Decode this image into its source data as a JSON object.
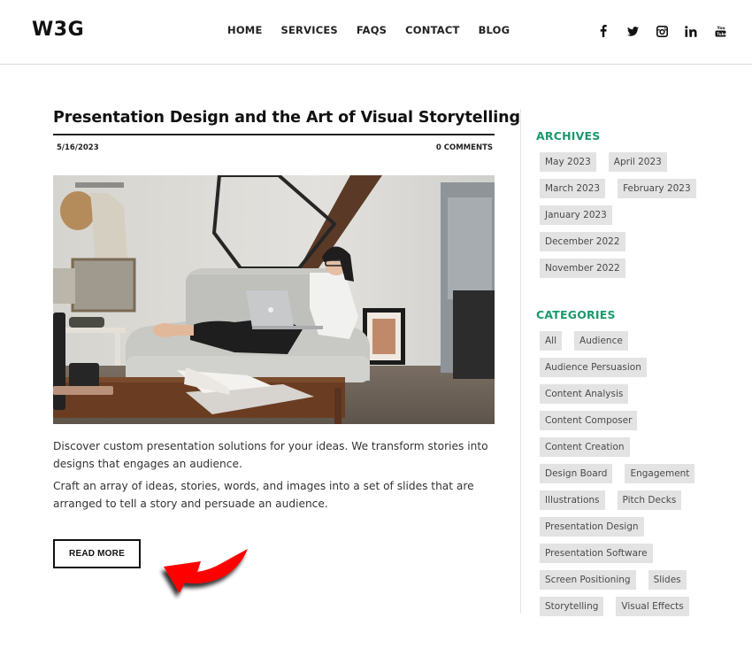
{
  "header": {
    "logo": "W3G",
    "nav": [
      "HOME",
      "SERVICES",
      "FAQS",
      "CONTACT",
      "BLOG"
    ],
    "social": [
      "facebook-icon",
      "twitter-icon",
      "instagram-icon",
      "linkedin-icon",
      "youtube-icon"
    ]
  },
  "article": {
    "title": "Presentation Design and the Art of Visual Storytelling",
    "date": "5/16/2023",
    "comments": "0 COMMENTS",
    "image_alt": "Woman with glasses working on a laptop while sitting on a grey sofa, coffee table with open book and magazines in foreground",
    "paragraphs": [
      "Discover custom presentation solutions for your ideas. We transform stories into designs that engages an audience.",
      "Craft an array of ideas, stories, words, and images into a set of slides that are arranged to tell a story and persuade an audience."
    ],
    "read_more": "READ MORE"
  },
  "sidebar": {
    "archives_title": "ARCHIVES",
    "archives": [
      "May 2023",
      "April 2023",
      "March 2023",
      "February 2023",
      "January 2023",
      "December 2022",
      "November 2022"
    ],
    "categories_title": "CATEGORIES",
    "categories": [
      "All",
      "Audience",
      "Audience Persuasion",
      "Content Analysis",
      "Content Composer",
      "Content Creation",
      "Design Board",
      "Engagement",
      "Illustrations",
      "Pitch Decks",
      "Presentation Design",
      "Presentation Software",
      "Screen Positioning",
      "Slides",
      "Storytelling",
      "Visual Effects"
    ]
  },
  "colors": {
    "accent_heading": "#1a9a6b",
    "tag_bg": "#e3e3e3",
    "annotation_arrow": "#ff0000"
  }
}
